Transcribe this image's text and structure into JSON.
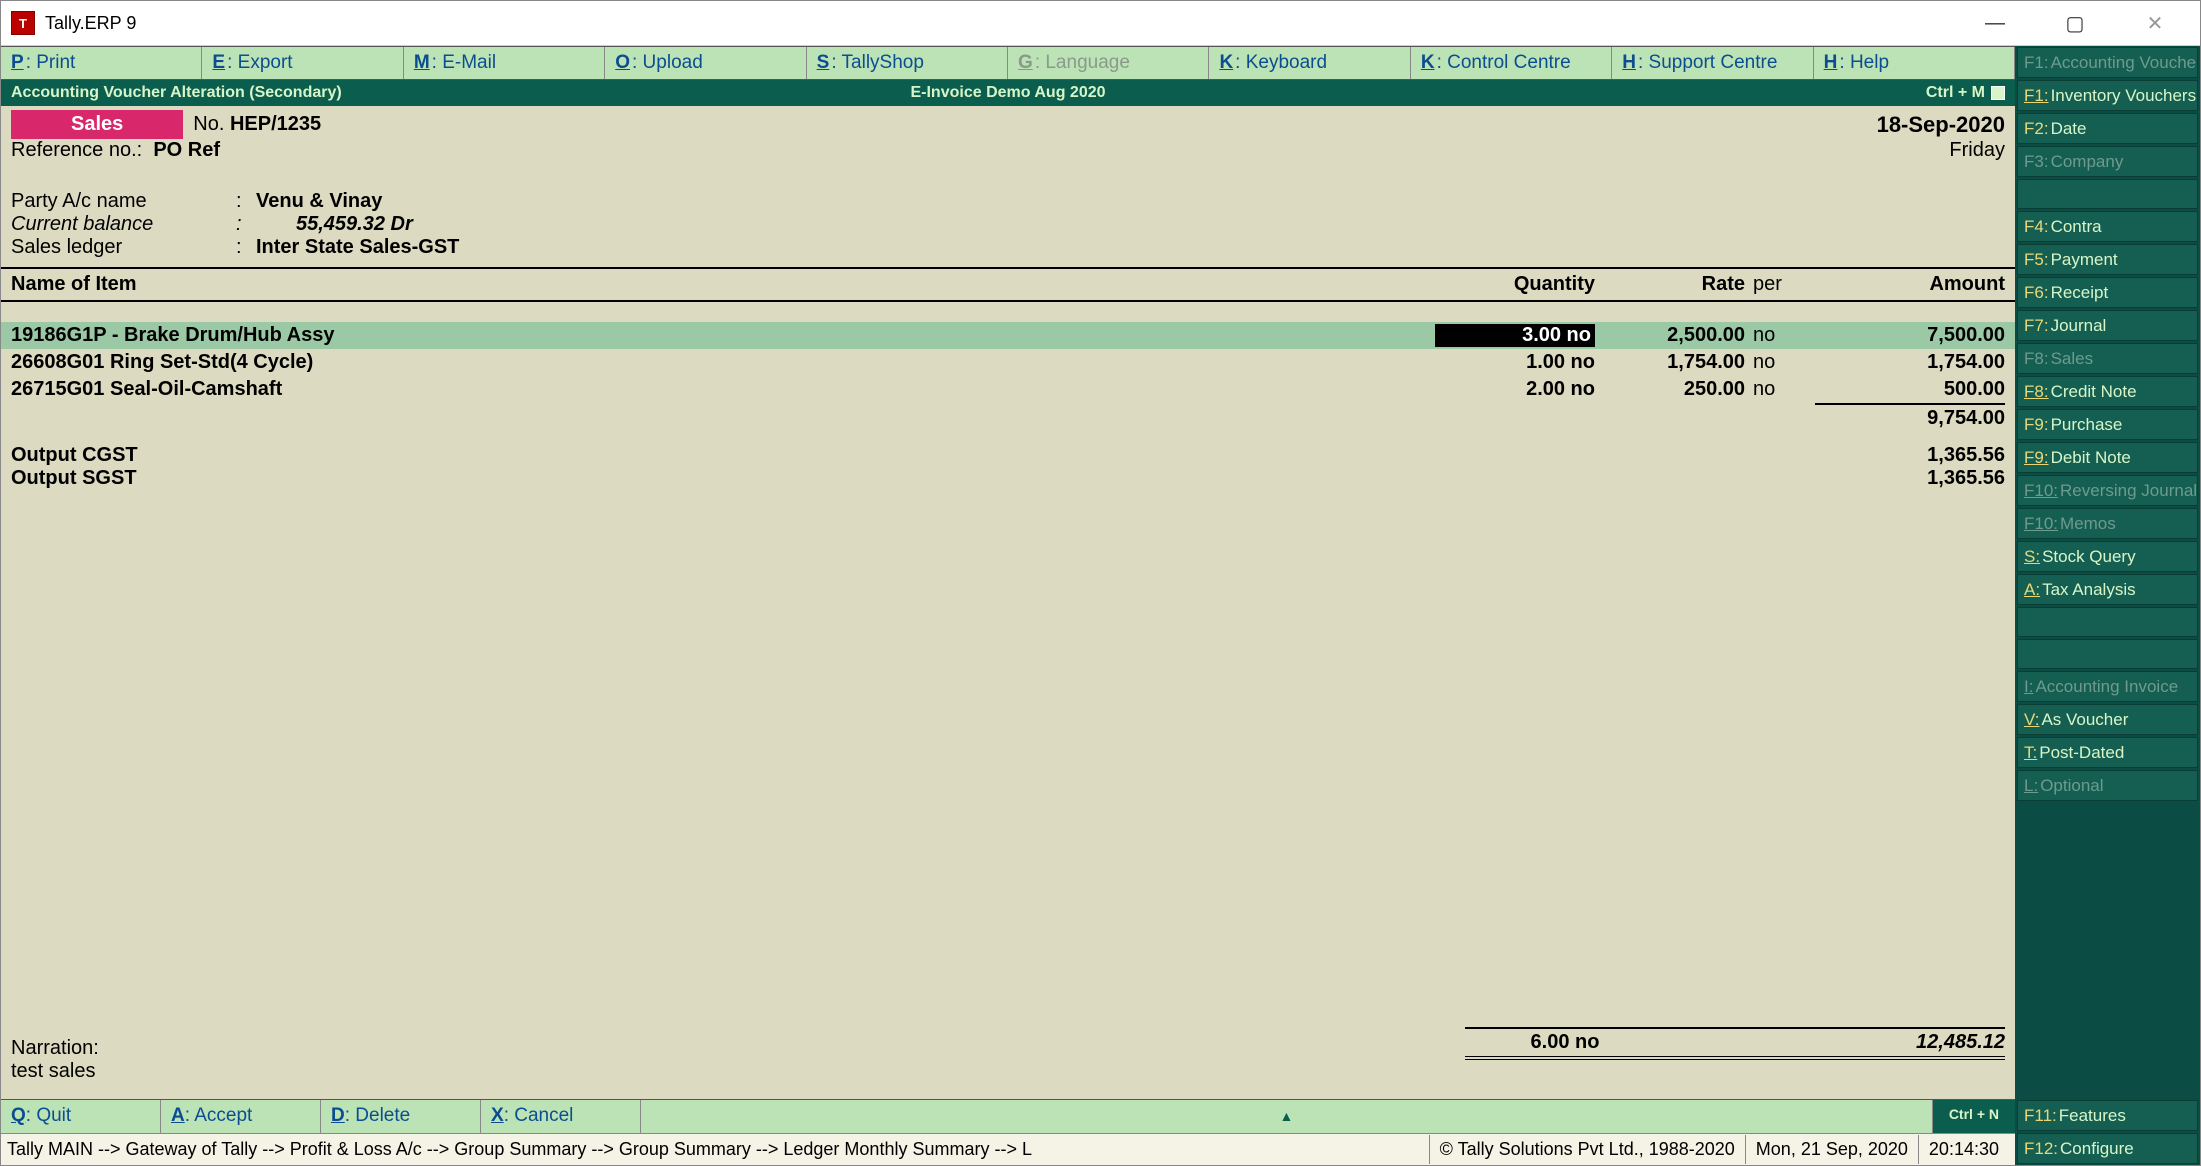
{
  "window": {
    "title": "Tally.ERP 9"
  },
  "topmenu": [
    {
      "key": "P",
      "label": ": Print",
      "underline": true,
      "disabled": false
    },
    {
      "key": "E",
      "label": ": Export",
      "underline": true,
      "disabled": false
    },
    {
      "key": "M",
      "label": ": E-Mail",
      "underline": true,
      "disabled": false
    },
    {
      "key": "O",
      "label": ": Upload",
      "underline": true,
      "disabled": false
    },
    {
      "key": "S",
      "label": ": TallyShop",
      "underline": true,
      "disabled": false
    },
    {
      "key": "G",
      "label": ": Language",
      "underline": true,
      "disabled": true
    },
    {
      "key": "K",
      "label": ": Keyboard",
      "underline": true,
      "disabled": false
    },
    {
      "key": "K",
      "label": ": Control Centre",
      "underline": true,
      "disabled": false
    },
    {
      "key": "H",
      "label": ": Support Centre",
      "underline": true,
      "disabled": false
    },
    {
      "key": "H",
      "label": ": Help",
      "underline": true,
      "disabled": false
    }
  ],
  "subbar": {
    "left": "Accounting Voucher  Alteration  (Secondary)",
    "center": "E-Invoice Demo Aug 2020",
    "right": "Ctrl + M"
  },
  "voucher": {
    "type": "Sales",
    "no_label": "No.",
    "no": "HEP/1235",
    "date": "18-Sep-2020",
    "ref_label": "Reference no.:",
    "ref": "PO Ref",
    "day": "Friday",
    "party_label": "Party A/c name",
    "party": "Venu & Vinay",
    "balance_label": "Current balance",
    "balance": "55,459.32 Dr",
    "ledger_label": "Sales ledger",
    "ledger": "Inter State Sales-GST"
  },
  "columns": {
    "name": "Name of Item",
    "qty": "Quantity",
    "rate": "Rate",
    "per": "per",
    "amount": "Amount"
  },
  "items": [
    {
      "name": "19186G1P - Brake Drum/Hub Assy",
      "qty": "3.00 no",
      "rate": "2,500.00",
      "per": "no",
      "amount": "7,500.00",
      "highlight": true,
      "editing": true
    },
    {
      "name": "26608G01 Ring Set-Std(4 Cycle)",
      "qty": "1.00 no",
      "rate": "1,754.00",
      "per": "no",
      "amount": "1,754.00",
      "highlight": false,
      "editing": false
    },
    {
      "name": "26715G01 Seal-Oil-Camshaft",
      "qty": "2.00 no",
      "rate": "250.00",
      "per": "no",
      "amount": "500.00",
      "highlight": false,
      "editing": false
    }
  ],
  "subtotal": "9,754.00",
  "taxes": [
    {
      "name": "Output CGST",
      "amount": "1,365.56"
    },
    {
      "name": "Output SGST",
      "amount": "1,365.56"
    }
  ],
  "narration": {
    "label": "Narration:",
    "text": "test sales"
  },
  "totals": {
    "qty": "6.00 no",
    "amount": "12,485.12"
  },
  "actions": [
    {
      "key": "Q",
      "label": ": Quit"
    },
    {
      "key": "A",
      "label": ": Accept"
    },
    {
      "key": "D",
      "label": ": Delete"
    },
    {
      "key": "X",
      "label": ": Cancel"
    }
  ],
  "ctrlN": "Ctrl + N",
  "statusbar": {
    "breadcrumb": "Tally MAIN --> Gateway of Tally --> Profit & Loss A/c --> Group Summary --> Group Summary --> Ledger Monthly Summary --> L",
    "copyright": "© Tally Solutions Pvt Ltd., 1988-2020",
    "date": "Mon, 21 Sep, 2020",
    "time": "20:14:30"
  },
  "sidebuttons": [
    {
      "key": "F1",
      "label": "Accounting Vouchers",
      "dim": true,
      "underline": false
    },
    {
      "key": "F1",
      "label": "Inventory Vouchers",
      "dim": false,
      "underline": true
    },
    {
      "key": "F2",
      "label": "Date",
      "dim": false,
      "underline": false
    },
    {
      "key": "F3",
      "label": "Company",
      "dim": true,
      "underline": false
    },
    {
      "gap": true
    },
    {
      "key": "F4",
      "label": "Contra",
      "dim": false,
      "underline": false
    },
    {
      "key": "F5",
      "label": "Payment",
      "dim": false,
      "underline": false
    },
    {
      "key": "F6",
      "label": "Receipt",
      "dim": false,
      "underline": false
    },
    {
      "key": "F7",
      "label": "Journal",
      "dim": false,
      "underline": false
    },
    {
      "key": "F8",
      "label": "Sales",
      "dim": true,
      "underline": false
    },
    {
      "key": "F8",
      "label": "Credit Note",
      "dim": false,
      "underline": true
    },
    {
      "key": "F9",
      "label": "Purchase",
      "dim": false,
      "underline": false
    },
    {
      "key": "F9",
      "label": "Debit Note",
      "dim": false,
      "underline": true
    },
    {
      "key": "F10",
      "label": "Reversing Journal",
      "dim": true,
      "underline": true
    },
    {
      "key": "F10",
      "label": "Memos",
      "dim": true,
      "underline": true
    },
    {
      "key": "S",
      "label": "Stock Query",
      "dim": false,
      "underline": true
    },
    {
      "key": "A",
      "label": "Tax Analysis",
      "dim": false,
      "underline": true
    },
    {
      "gap": true
    },
    {
      "gap": true
    },
    {
      "key": "I",
      "label": "Accounting Invoice",
      "dim": true,
      "underline": true
    },
    {
      "key": "V",
      "label": "As Voucher",
      "dim": false,
      "underline": true
    },
    {
      "key": "T",
      "label": "Post-Dated",
      "dim": false,
      "underline": true
    },
    {
      "key": "L",
      "label": "Optional",
      "dim": true,
      "underline": true
    },
    {
      "spacer": true
    },
    {
      "key": "F11",
      "label": "Features",
      "dim": false,
      "underline": false
    },
    {
      "key": "F12",
      "label": "Configure",
      "dim": false,
      "underline": false
    }
  ]
}
